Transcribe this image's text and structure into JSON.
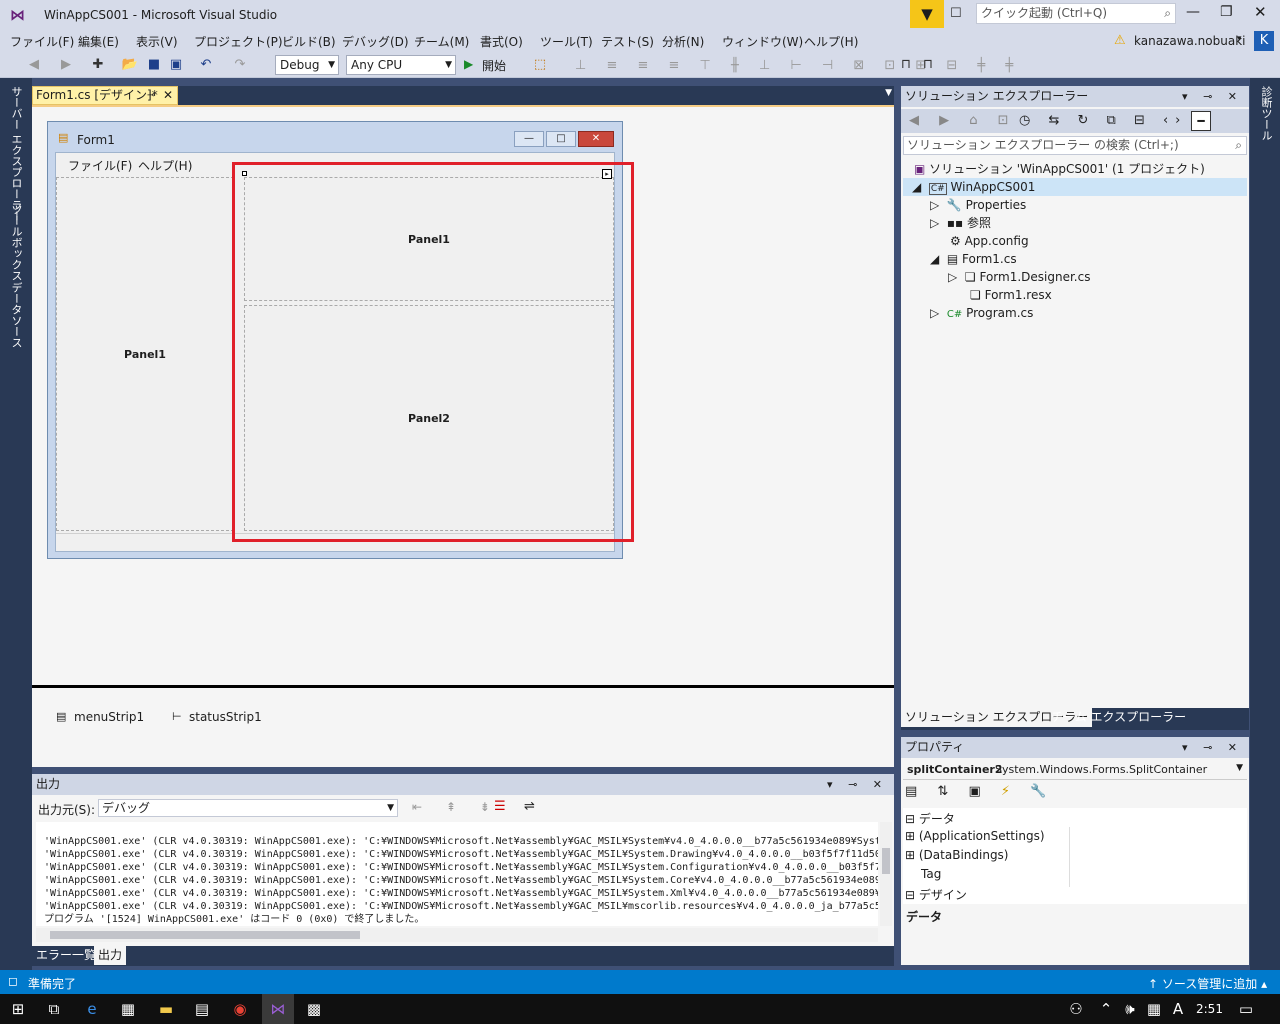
{
  "window": {
    "title": "WinAppCS001 - Microsoft Visual Studio",
    "quick_launch": "クイック起動 (Ctrl+Q)",
    "user": "kanazawa.nobuaki",
    "avatar_letter": "K"
  },
  "menu": [
    "ファイル(F)",
    "編集(E)",
    "表示(V)",
    "プロジェクト(P)",
    "ビルド(B)",
    "デバッグ(D)",
    "チーム(M)",
    "書式(O)",
    "ツール(T)",
    "テスト(S)",
    "分析(N)",
    "ウィンドウ(W)",
    "ヘルプ(H)"
  ],
  "toolbar": {
    "config": "Debug",
    "platform": "Any CPU",
    "start": "開始"
  },
  "left_tabs": [
    "サーバー エクスプローラー",
    "ツールボックス",
    "データソース"
  ],
  "right_tabs": [
    "診断ツール"
  ],
  "doc_tab": {
    "label": "Form1.cs [デザイン]*"
  },
  "form": {
    "title": "Form1",
    "menu": [
      "ファイル(F)",
      "ヘルプ(H)"
    ],
    "panel_left": "Panel1",
    "panel_top": "Panel1",
    "panel_bottom": "Panel2"
  },
  "tray": [
    "menuStrip1",
    "statusStrip1"
  ],
  "output": {
    "title": "出力",
    "source_label": "出力元(S):",
    "source": "デバッグ",
    "lines": [
      "'WinAppCS001.exe' (CLR v4.0.30319: WinAppCS001.exe): 'C:¥WINDOWS¥Microsoft.Net¥assembly¥GAC_MSIL¥System¥v4.0_4.0.0.0__b77a5c561934e089¥Syst",
      "'WinAppCS001.exe' (CLR v4.0.30319: WinAppCS001.exe): 'C:¥WINDOWS¥Microsoft.Net¥assembly¥GAC_MSIL¥System.Drawing¥v4.0_4.0.0.0__b03f5f7f11d50",
      "'WinAppCS001.exe' (CLR v4.0.30319: WinAppCS001.exe): 'C:¥WINDOWS¥Microsoft.Net¥assembly¥GAC_MSIL¥System.Configuration¥v4.0_4.0.0.0__b03f5f7",
      "'WinAppCS001.exe' (CLR v4.0.30319: WinAppCS001.exe): 'C:¥WINDOWS¥Microsoft.Net¥assembly¥GAC_MSIL¥System.Core¥v4.0_4.0.0.0__b77a5c561934e089",
      "'WinAppCS001.exe' (CLR v4.0.30319: WinAppCS001.exe): 'C:¥WINDOWS¥Microsoft.Net¥assembly¥GAC_MSIL¥System.Xml¥v4.0_4.0.0.0__b77a5c561934e089¥",
      "'WinAppCS001.exe' (CLR v4.0.30319: WinAppCS001.exe): 'C:¥WINDOWS¥Microsoft.Net¥assembly¥GAC_MSIL¥mscorlib.resources¥v4.0_4.0.0.0_ja_b77a5c5",
      "プログラム '[1524] WinAppCS001.exe' はコード 0 (0x0) で終了しました。"
    ],
    "tabs": [
      "エラー一覧",
      "出力"
    ]
  },
  "solution": {
    "title": "ソリューション エクスプローラー",
    "search": "ソリューション エクスプローラー の検索 (Ctrl+;)",
    "items": [
      "ソリューション 'WinAppCS001' (1 プロジェクト)",
      "WinAppCS001",
      "Properties",
      "参照",
      "App.config",
      "Form1.cs",
      "Form1.Designer.cs",
      "Form1.resx",
      "Program.cs"
    ],
    "tabs": [
      "ソリューション エクスプローラー",
      "チーム エクスプローラー"
    ]
  },
  "properties": {
    "title": "プロパティ",
    "object": "splitContainer2",
    "type": "System.Windows.Forms.SplitContainer",
    "rows": [
      "データ",
      "(ApplicationSettings)",
      "(DataBindings)",
      "Tag",
      "デザイン"
    ],
    "description": "データ"
  },
  "status": {
    "text": "準備完了",
    "source_control": "ソース管理に追加"
  },
  "taskbar": {
    "time": "2:51",
    "ime": "A"
  }
}
